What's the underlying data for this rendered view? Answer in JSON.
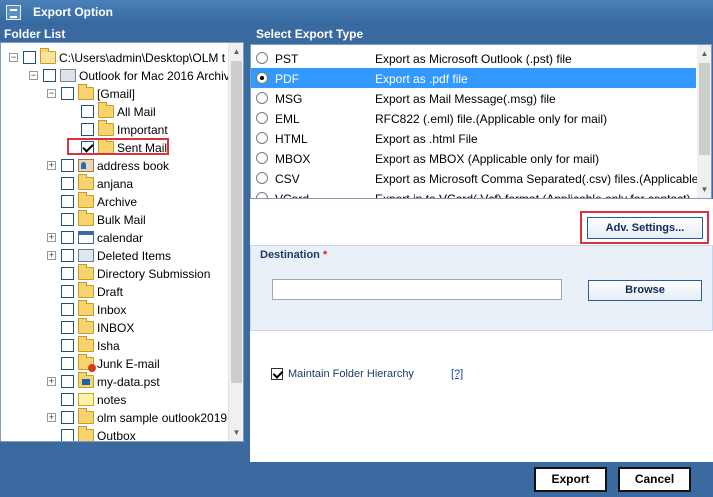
{
  "window": {
    "title": "Export Option"
  },
  "folder_list": {
    "header": "Folder List",
    "items": [
      {
        "label": "C:\\Users\\admin\\Desktop\\OLM t",
        "icon": "open-folder-icon",
        "level": 0,
        "expander": "−",
        "checked": false
      },
      {
        "label": "Outlook for Mac 2016 Archiv",
        "icon": "archive-icon",
        "level": 1,
        "expander": "−",
        "checked": false
      },
      {
        "label": "[Gmail]",
        "icon": "folder-icon",
        "level": 2,
        "expander": "−",
        "checked": false
      },
      {
        "label": "All Mail",
        "icon": "folder-icon",
        "level": 3,
        "expander": "",
        "checked": false
      },
      {
        "label": "Important",
        "icon": "folder-icon",
        "level": 3,
        "expander": "",
        "checked": false
      },
      {
        "label": "Sent Mail",
        "icon": "folder-icon",
        "level": 3,
        "expander": "",
        "checked": true
      },
      {
        "label": "address book",
        "icon": "contacts-icon",
        "level": 2,
        "expander": "+",
        "checked": false
      },
      {
        "label": "anjana",
        "icon": "folder-icon",
        "level": 2,
        "expander": "",
        "checked": false
      },
      {
        "label": "Archive",
        "icon": "folder-icon",
        "level": 2,
        "expander": "",
        "checked": false
      },
      {
        "label": "Bulk Mail",
        "icon": "folder-icon",
        "level": 2,
        "expander": "",
        "checked": false
      },
      {
        "label": "calendar",
        "icon": "calendar-icon",
        "level": 2,
        "expander": "+",
        "checked": false
      },
      {
        "label": "Deleted Items",
        "icon": "trash-icon",
        "level": 2,
        "expander": "+",
        "checked": false
      },
      {
        "label": "Directory Submission",
        "icon": "folder-icon",
        "level": 2,
        "expander": "",
        "checked": false
      },
      {
        "label": "Draft",
        "icon": "folder-icon",
        "level": 2,
        "expander": "",
        "checked": false
      },
      {
        "label": "Inbox",
        "icon": "inbox-icon",
        "level": 2,
        "expander": "",
        "checked": false
      },
      {
        "label": "INBOX",
        "icon": "folder-icon",
        "level": 2,
        "expander": "",
        "checked": false
      },
      {
        "label": "Isha",
        "icon": "folder-icon",
        "level": 2,
        "expander": "",
        "checked": false
      },
      {
        "label": "Junk E-mail",
        "icon": "junk-icon",
        "level": 2,
        "expander": "",
        "checked": false
      },
      {
        "label": "my-data.pst",
        "icon": "pst-folder-icon",
        "level": 2,
        "expander": "+",
        "checked": false
      },
      {
        "label": "notes",
        "icon": "notes-icon",
        "level": 2,
        "expander": "",
        "checked": false
      },
      {
        "label": "olm sample outlook2019",
        "icon": "folder-icon",
        "level": 2,
        "expander": "+",
        "checked": false
      },
      {
        "label": "Outbox",
        "icon": "folder-icon",
        "level": 2,
        "expander": "",
        "checked": false
      }
    ]
  },
  "export_type": {
    "header": "Select Export Type",
    "options": [
      {
        "name": "PST",
        "desc": "Export as Microsoft Outlook (.pst) file",
        "selected": false
      },
      {
        "name": "PDF",
        "desc": "Export as .pdf file",
        "selected": true
      },
      {
        "name": "MSG",
        "desc": "Export as Mail Message(.msg) file",
        "selected": false
      },
      {
        "name": "EML",
        "desc": "RFC822 (.eml) file.(Applicable only for mail)",
        "selected": false
      },
      {
        "name": "HTML",
        "desc": "Export as .html File",
        "selected": false
      },
      {
        "name": "MBOX",
        "desc": "Export as MBOX (Applicable only for mail)",
        "selected": false
      },
      {
        "name": "CSV",
        "desc": "Export as Microsoft Comma Separated(.csv) files.(Applicable ...",
        "selected": false
      },
      {
        "name": "VCard",
        "desc": "Export in to VCard(.Vcf) format.(Applicable only for contact)",
        "selected": false
      }
    ]
  },
  "adv_settings_label": "Adv. Settings...",
  "destination": {
    "label": "Destination",
    "required_mark": "*",
    "value": "",
    "browse_label": "Browse"
  },
  "maintain_hierarchy": {
    "label": "Maintain Folder Hierarchy",
    "checked": true,
    "help": "[?]"
  },
  "footer": {
    "export_label": "Export",
    "cancel_label": "Cancel"
  },
  "colors": {
    "title_bar": "#3a6aa0",
    "selected_row": "#3399ff",
    "highlight_box": "#d9343a"
  }
}
